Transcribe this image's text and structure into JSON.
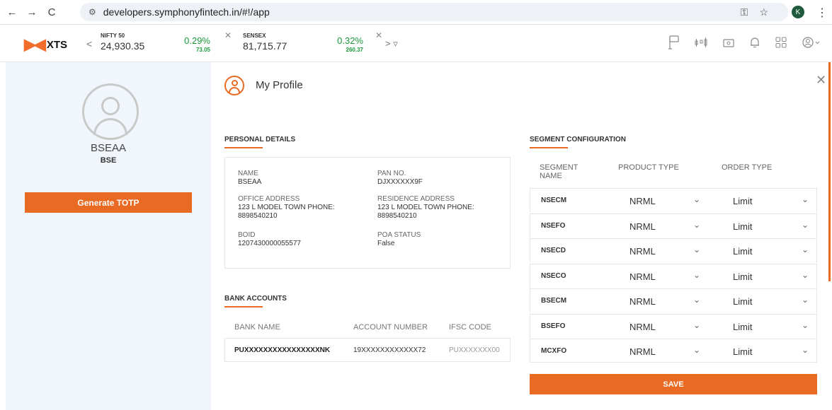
{
  "browser": {
    "back": "←",
    "forward": "→",
    "reload": "C",
    "site_info": "⚙",
    "url": "developers.symphonyfintech.in/#!/app",
    "key_icon": "⚿",
    "star_icon": "☆",
    "avatar_letter": "K",
    "menu_icon": "⋮"
  },
  "header": {
    "logo_text": "XTS",
    "tickers": [
      {
        "name": "NIFTY 50",
        "price": "24,930.35",
        "change_pct": "0.29%",
        "change_val": "73.05"
      },
      {
        "name": "SENSEX",
        "price": "81,715.77",
        "change_pct": "0.32%",
        "change_val": "260.37"
      }
    ],
    "close_glyph": "✕",
    "prev_glyph": "<",
    "next_glyph": "> ▿"
  },
  "left": {
    "user_name": "BSEAA",
    "exchange": "BSE",
    "totp_label": "Generate TOTP"
  },
  "main": {
    "title": "My Profile",
    "close_glyph": "✕",
    "personal_title": "PERSONAL DETAILS",
    "personal": {
      "name_label": "NAME",
      "name": "BSEAA",
      "pan_label": "PAN NO.",
      "pan": "DJXXXXXX9F",
      "office_label": "OFFICE ADDRESS",
      "office": "123 L MODEL TOWN PHONE: 8898540210",
      "residence_label": "RESIDENCE ADDRESS",
      "residence": "123 L MODEL TOWN PHONE: 8898540210",
      "boid_label": "BOID",
      "boid": "1207430000055577",
      "poa_label": "POA STATUS",
      "poa": "False"
    },
    "bank_title": "BANK ACCOUNTS",
    "bank_headers": [
      "BANK NAME",
      "ACCOUNT NUMBER",
      "IFSC CODE"
    ],
    "bank_row": [
      "PUXXXXXXXXXXXXXXXXNK",
      "19XXXXXXXXXXXX72",
      "PUXXXXXXX00"
    ],
    "segment_title": "SEGMENT CONFIGURATION",
    "segment_headers": [
      "SEGMENT NAME",
      "PRODUCT TYPE",
      "ORDER TYPE"
    ],
    "segments": [
      {
        "name": "NSECM",
        "product": "NRML",
        "order": "Limit"
      },
      {
        "name": "NSEFO",
        "product": "NRML",
        "order": "Limit"
      },
      {
        "name": "NSECD",
        "product": "NRML",
        "order": "Limit"
      },
      {
        "name": "NSECO",
        "product": "NRML",
        "order": "Limit"
      },
      {
        "name": "BSECM",
        "product": "NRML",
        "order": "Limit"
      },
      {
        "name": "BSEFO",
        "product": "NRML",
        "order": "Limit"
      },
      {
        "name": "MCXFO",
        "product": "NRML",
        "order": "Limit"
      }
    ],
    "chevron": "⌄",
    "save_label": "SAVE"
  },
  "colors": {
    "accent": "#e86a23",
    "gain": "#1a9a3a"
  }
}
